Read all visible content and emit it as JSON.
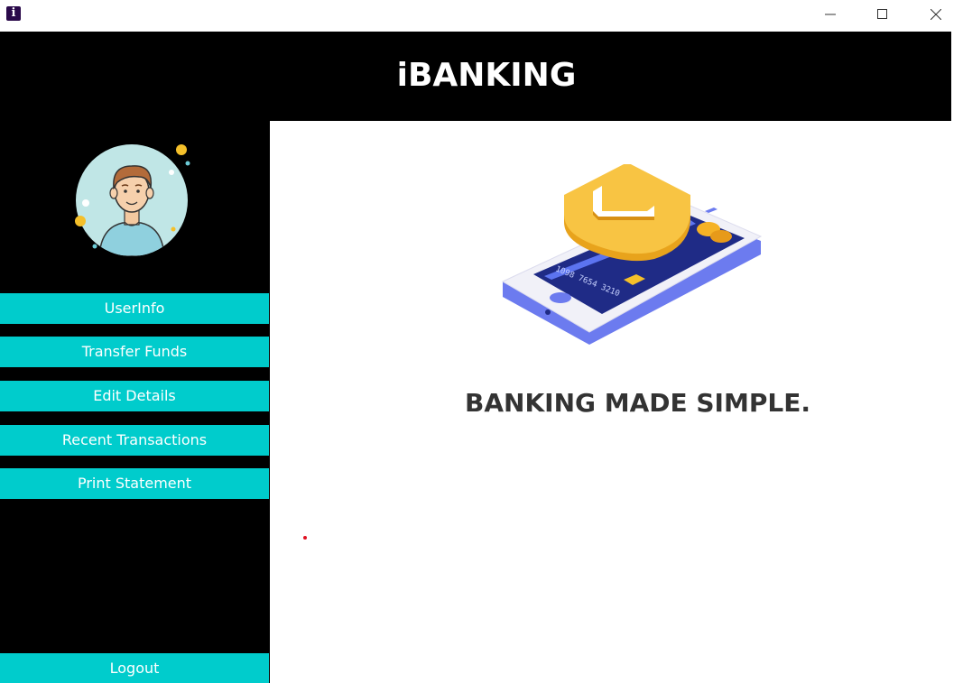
{
  "window": {
    "app_icon_letter": "i",
    "accent": "#00cccc",
    "header_bg": "#000000"
  },
  "header": {
    "title": "iBANKING"
  },
  "sidebar": {
    "items": [
      {
        "label": "UserInfo"
      },
      {
        "label": "Transfer Funds"
      },
      {
        "label": "Edit Details"
      },
      {
        "label": "Recent Transactions"
      },
      {
        "label": "Print Statement"
      }
    ],
    "logout_label": "Logout"
  },
  "main": {
    "tagline": "BANKING MADE SIMPLE.",
    "card_number": "1098 7654 3210",
    "marker_color": "#e01020"
  },
  "icons": [
    "app-icon",
    "minimize-icon",
    "maximize-icon",
    "close-icon",
    "user-avatar",
    "secure-phone-illustration"
  ]
}
